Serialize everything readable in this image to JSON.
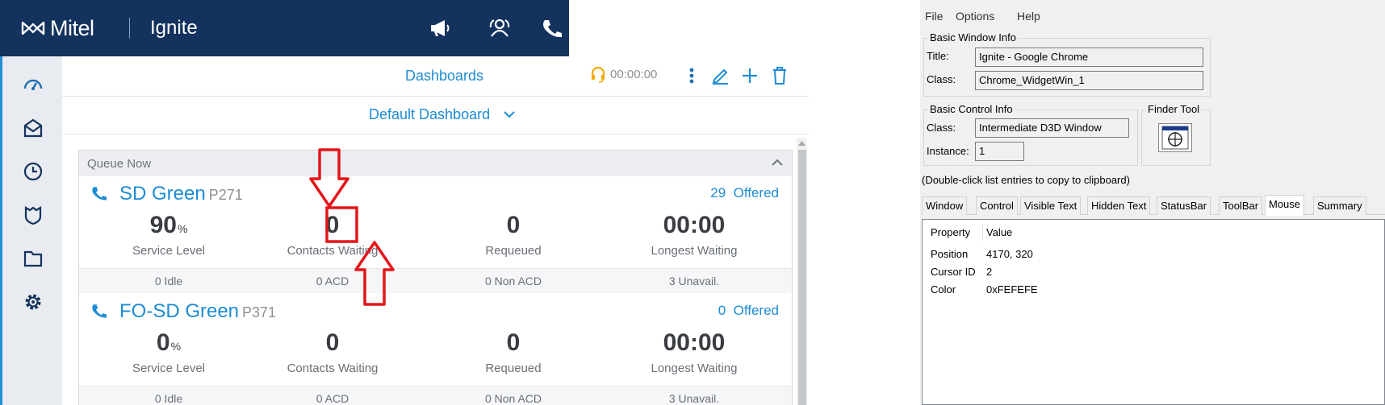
{
  "app": {
    "brand": "Mitel",
    "product": "Ignite",
    "header_icons": [
      "megaphone-icon",
      "contacts-icon",
      "phone-icon"
    ],
    "nav_icons": [
      "dashboard-icon",
      "inbox-icon",
      "history-icon",
      "shield-icon",
      "folder-icon",
      "settings-icon"
    ],
    "toolbar": {
      "title": "Dashboards",
      "timer": "00:00:00"
    },
    "dashboard_selector": "Default Dashboard",
    "widget": {
      "title": "Queue Now",
      "queues": [
        {
          "name": "SD Green",
          "id": "P271",
          "offered_count": "29",
          "offered_label": "Offered",
          "metrics": [
            {
              "value": "90",
              "unit": "%",
              "label": "Service Level"
            },
            {
              "value": "0",
              "unit": "",
              "label": "Contacts Waiting"
            },
            {
              "value": "0",
              "unit": "",
              "label": "Requeued"
            },
            {
              "value": "00:00",
              "unit": "",
              "label": "Longest Waiting"
            }
          ],
          "footer": [
            "0 Idle",
            "0 ACD",
            "0 Non ACD",
            "3 Unavail."
          ]
        },
        {
          "name": "FO-SD Green",
          "id": "P371",
          "offered_count": "0",
          "offered_label": "Offered",
          "metrics": [
            {
              "value": "0",
              "unit": "%",
              "label": "Service Level"
            },
            {
              "value": "0",
              "unit": "",
              "label": "Contacts Waiting"
            },
            {
              "value": "0",
              "unit": "",
              "label": "Requeued"
            },
            {
              "value": "00:00",
              "unit": "",
              "label": "Longest Waiting"
            }
          ],
          "footer": [
            "0 Idle",
            "0 ACD",
            "0 Non ACD",
            "3 Unavail."
          ]
        }
      ]
    },
    "colors": {
      "header": "#14325e",
      "accent": "#1d8cd3",
      "annotation": "#e3151a"
    }
  },
  "window_info": {
    "menu": [
      "File",
      "Options",
      "Help"
    ],
    "basic_window": {
      "title": "Basic Window Info",
      "title_label": "Title:",
      "title_value": "Ignite - Google Chrome",
      "class_label": "Class:",
      "class_value": "Chrome_WidgetWin_1"
    },
    "basic_control": {
      "title": "Basic Control Info",
      "class_label": "Class:",
      "class_value": "Intermediate D3D Window",
      "instance_label": "Instance:",
      "instance_value": "1"
    },
    "finder": {
      "title": "Finder Tool"
    },
    "hint": "(Double-click list entries to copy to clipboard)",
    "tabs": [
      "Window",
      "Control",
      "Visible Text",
      "Hidden Text",
      "StatusBar",
      "ToolBar",
      "Mouse",
      "Summary"
    ],
    "active_tab": "Mouse",
    "list": {
      "headers": [
        "Property",
        "Value"
      ],
      "rows": [
        {
          "property": "Position",
          "value": "4170, 320"
        },
        {
          "property": "Cursor ID",
          "value": "2"
        },
        {
          "property": "Color",
          "value": "0xFEFEFE"
        }
      ]
    }
  }
}
